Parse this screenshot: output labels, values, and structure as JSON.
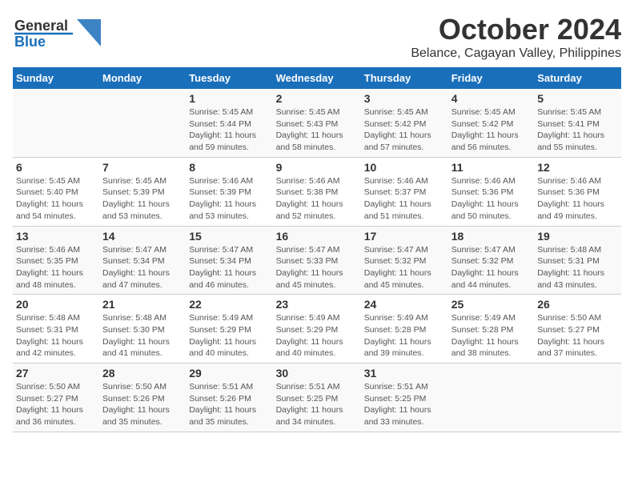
{
  "header": {
    "logo": {
      "line1": "General",
      "line2": "Blue"
    },
    "title": "October 2024",
    "subtitle": "Belance, Cagayan Valley, Philippines"
  },
  "weekdays": [
    "Sunday",
    "Monday",
    "Tuesday",
    "Wednesday",
    "Thursday",
    "Friday",
    "Saturday"
  ],
  "weeks": [
    [
      {
        "day": "",
        "info": ""
      },
      {
        "day": "",
        "info": ""
      },
      {
        "day": "1",
        "info": "Sunrise: 5:45 AM\nSunset: 5:44 PM\nDaylight: 11 hours and 59 minutes."
      },
      {
        "day": "2",
        "info": "Sunrise: 5:45 AM\nSunset: 5:43 PM\nDaylight: 11 hours and 58 minutes."
      },
      {
        "day": "3",
        "info": "Sunrise: 5:45 AM\nSunset: 5:42 PM\nDaylight: 11 hours and 57 minutes."
      },
      {
        "day": "4",
        "info": "Sunrise: 5:45 AM\nSunset: 5:42 PM\nDaylight: 11 hours and 56 minutes."
      },
      {
        "day": "5",
        "info": "Sunrise: 5:45 AM\nSunset: 5:41 PM\nDaylight: 11 hours and 55 minutes."
      }
    ],
    [
      {
        "day": "6",
        "info": "Sunrise: 5:45 AM\nSunset: 5:40 PM\nDaylight: 11 hours and 54 minutes."
      },
      {
        "day": "7",
        "info": "Sunrise: 5:45 AM\nSunset: 5:39 PM\nDaylight: 11 hours and 53 minutes."
      },
      {
        "day": "8",
        "info": "Sunrise: 5:46 AM\nSunset: 5:39 PM\nDaylight: 11 hours and 53 minutes."
      },
      {
        "day": "9",
        "info": "Sunrise: 5:46 AM\nSunset: 5:38 PM\nDaylight: 11 hours and 52 minutes."
      },
      {
        "day": "10",
        "info": "Sunrise: 5:46 AM\nSunset: 5:37 PM\nDaylight: 11 hours and 51 minutes."
      },
      {
        "day": "11",
        "info": "Sunrise: 5:46 AM\nSunset: 5:36 PM\nDaylight: 11 hours and 50 minutes."
      },
      {
        "day": "12",
        "info": "Sunrise: 5:46 AM\nSunset: 5:36 PM\nDaylight: 11 hours and 49 minutes."
      }
    ],
    [
      {
        "day": "13",
        "info": "Sunrise: 5:46 AM\nSunset: 5:35 PM\nDaylight: 11 hours and 48 minutes."
      },
      {
        "day": "14",
        "info": "Sunrise: 5:47 AM\nSunset: 5:34 PM\nDaylight: 11 hours and 47 minutes."
      },
      {
        "day": "15",
        "info": "Sunrise: 5:47 AM\nSunset: 5:34 PM\nDaylight: 11 hours and 46 minutes."
      },
      {
        "day": "16",
        "info": "Sunrise: 5:47 AM\nSunset: 5:33 PM\nDaylight: 11 hours and 45 minutes."
      },
      {
        "day": "17",
        "info": "Sunrise: 5:47 AM\nSunset: 5:32 PM\nDaylight: 11 hours and 45 minutes."
      },
      {
        "day": "18",
        "info": "Sunrise: 5:47 AM\nSunset: 5:32 PM\nDaylight: 11 hours and 44 minutes."
      },
      {
        "day": "19",
        "info": "Sunrise: 5:48 AM\nSunset: 5:31 PM\nDaylight: 11 hours and 43 minutes."
      }
    ],
    [
      {
        "day": "20",
        "info": "Sunrise: 5:48 AM\nSunset: 5:31 PM\nDaylight: 11 hours and 42 minutes."
      },
      {
        "day": "21",
        "info": "Sunrise: 5:48 AM\nSunset: 5:30 PM\nDaylight: 11 hours and 41 minutes."
      },
      {
        "day": "22",
        "info": "Sunrise: 5:49 AM\nSunset: 5:29 PM\nDaylight: 11 hours and 40 minutes."
      },
      {
        "day": "23",
        "info": "Sunrise: 5:49 AM\nSunset: 5:29 PM\nDaylight: 11 hours and 40 minutes."
      },
      {
        "day": "24",
        "info": "Sunrise: 5:49 AM\nSunset: 5:28 PM\nDaylight: 11 hours and 39 minutes."
      },
      {
        "day": "25",
        "info": "Sunrise: 5:49 AM\nSunset: 5:28 PM\nDaylight: 11 hours and 38 minutes."
      },
      {
        "day": "26",
        "info": "Sunrise: 5:50 AM\nSunset: 5:27 PM\nDaylight: 11 hours and 37 minutes."
      }
    ],
    [
      {
        "day": "27",
        "info": "Sunrise: 5:50 AM\nSunset: 5:27 PM\nDaylight: 11 hours and 36 minutes."
      },
      {
        "day": "28",
        "info": "Sunrise: 5:50 AM\nSunset: 5:26 PM\nDaylight: 11 hours and 35 minutes."
      },
      {
        "day": "29",
        "info": "Sunrise: 5:51 AM\nSunset: 5:26 PM\nDaylight: 11 hours and 35 minutes."
      },
      {
        "day": "30",
        "info": "Sunrise: 5:51 AM\nSunset: 5:25 PM\nDaylight: 11 hours and 34 minutes."
      },
      {
        "day": "31",
        "info": "Sunrise: 5:51 AM\nSunset: 5:25 PM\nDaylight: 11 hours and 33 minutes."
      },
      {
        "day": "",
        "info": ""
      },
      {
        "day": "",
        "info": ""
      }
    ]
  ]
}
